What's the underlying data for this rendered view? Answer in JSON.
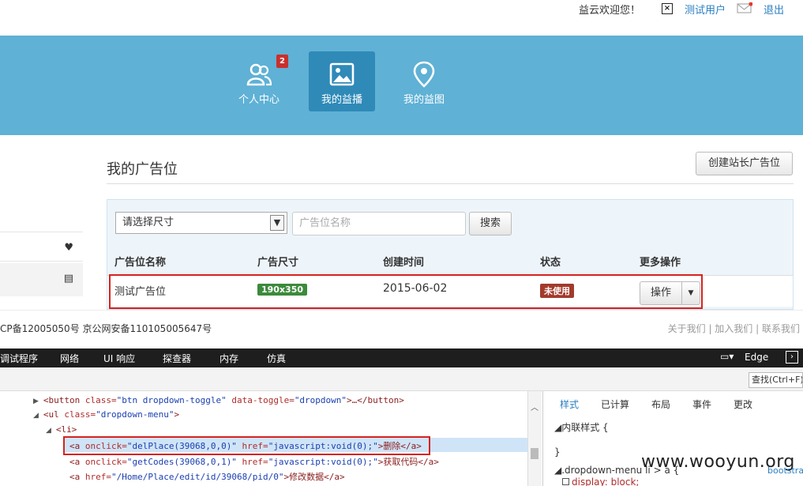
{
  "topbar": {
    "welcome": "益云欢迎您！",
    "close_glyph": "×",
    "user": "测试用户",
    "logout": "退出"
  },
  "nav": {
    "items": [
      {
        "label": "个人中心",
        "badge": "2"
      },
      {
        "label": "我的益播"
      },
      {
        "label": "我的益图"
      }
    ]
  },
  "main": {
    "title": "我的广告位",
    "create_button": "创建站长广告位",
    "filter": {
      "size_select": "请选择尺寸",
      "name_placeholder": "广告位名称",
      "search_button": "搜索"
    },
    "table": {
      "headers": [
        "广告位名称",
        "广告尺寸",
        "创建时间",
        "状态",
        "更多操作"
      ],
      "rows": [
        {
          "name": "测试广告位",
          "size": "190x350",
          "created": "2015-06-02",
          "status": "未使用",
          "action": "操作"
        }
      ]
    }
  },
  "footer": {
    "icp": "CP备12005050号 京公网安备110105005647号",
    "links": [
      "关于我们",
      "加入我们",
      "联系我们"
    ]
  },
  "devtools": {
    "tabs": [
      "调试程序",
      "网络",
      "UI 响应",
      "探查器",
      "内存",
      "仿真"
    ],
    "browser": "Edge",
    "find_placeholder": "查找(Ctrl+F)",
    "dom_lines": [
      {
        "tag_open": "<button",
        "attrs": [
          [
            "class",
            "btn dropdown-toggle"
          ],
          [
            "data-toggle",
            "dropdown"
          ]
        ],
        "tail": ">…</button>"
      },
      {
        "tag_open": "<ul",
        "attrs": [
          [
            "class",
            "dropdown-menu"
          ]
        ],
        "tail": ">"
      },
      {
        "tag_open": "<li",
        "attrs": [],
        "tail": ">"
      },
      {
        "tag_open": "<a",
        "attrs": [
          [
            "onclick",
            "delPlace(39068,0,0)"
          ],
          [
            "href",
            "javascript:void(0);"
          ]
        ],
        "tail": ">删除</a>"
      },
      {
        "tag_open": "<a",
        "attrs": [
          [
            "onclick",
            "getCodes(39068,0,1)"
          ],
          [
            "href",
            "javascript:void(0);"
          ]
        ],
        "tail": ">获取代码</a>"
      },
      {
        "tag_open": "<a",
        "attrs": [
          [
            "href",
            "/Home/Place/edit/id/39068/pid/0"
          ]
        ],
        "tail": ">修改数据</a>"
      }
    ],
    "style_tabs": [
      "样式",
      "已计算",
      "布局",
      "事件",
      "更改"
    ],
    "style_lines": [
      "◢内联样式  {",
      "}",
      "◢.dropdown-menu li > a  {",
      "display: block;"
    ],
    "source_link": "bootstra"
  },
  "watermark": "www.wooyun.org",
  "colors": {
    "nav_bg": "#5fb1d5",
    "nav_active": "#2f8ab8",
    "link": "#2a7fc1",
    "size_badge": "#3c8a3c",
    "status_badge": "#a33a2c",
    "highlight": "#d6231f"
  }
}
